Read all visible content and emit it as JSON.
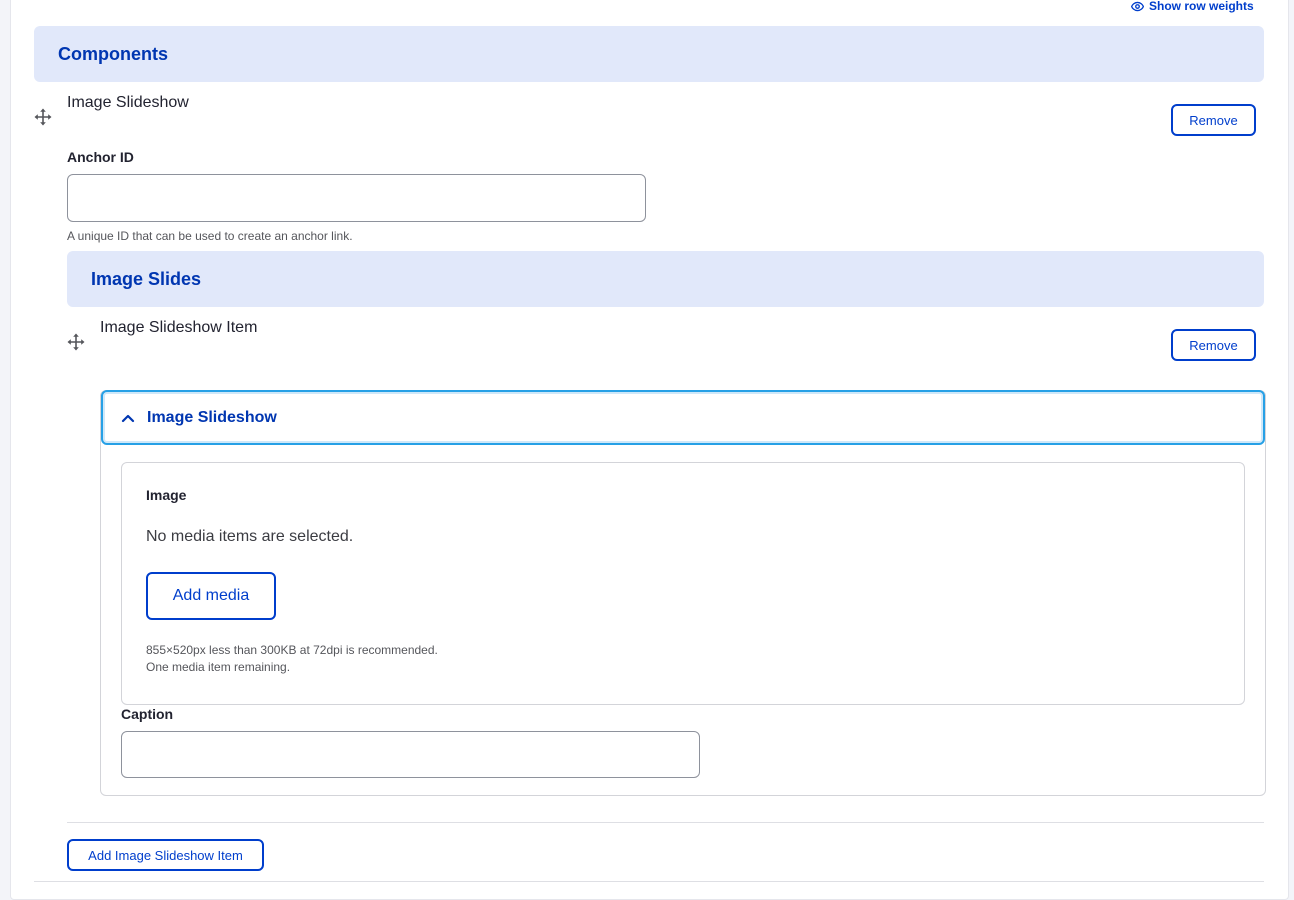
{
  "header": {
    "row_weights_label": "Show row weights"
  },
  "components_section": {
    "title": "Components"
  },
  "component_item": {
    "title": "Image Slideshow",
    "remove_label": "Remove",
    "anchor": {
      "label": "Anchor ID",
      "value": "",
      "description": "A unique ID that can be used to create an anchor link."
    }
  },
  "slides_section": {
    "title": "Image Slides"
  },
  "slide_item": {
    "title": "Image Slideshow Item",
    "remove_label": "Remove",
    "details": {
      "summary": "Image Slideshow",
      "image": {
        "label": "Image",
        "empty_text": "No media items are selected.",
        "add_media_label": "Add media",
        "help_line1": "855×520px less than 300KB at 72dpi is recommended.",
        "help_line2": "One media item remaining."
      },
      "caption": {
        "label": "Caption",
        "value": ""
      }
    }
  },
  "add_item_label": "Add Image Slideshow Item",
  "colors": {
    "accent": "#003ecc",
    "band_bg": "#e1e8fa",
    "focus_ring": "#26a0e6"
  },
  "icons": {
    "eye": "eye-icon",
    "drag": "drag-handle-icon",
    "chevron": "chevron-up-icon"
  }
}
